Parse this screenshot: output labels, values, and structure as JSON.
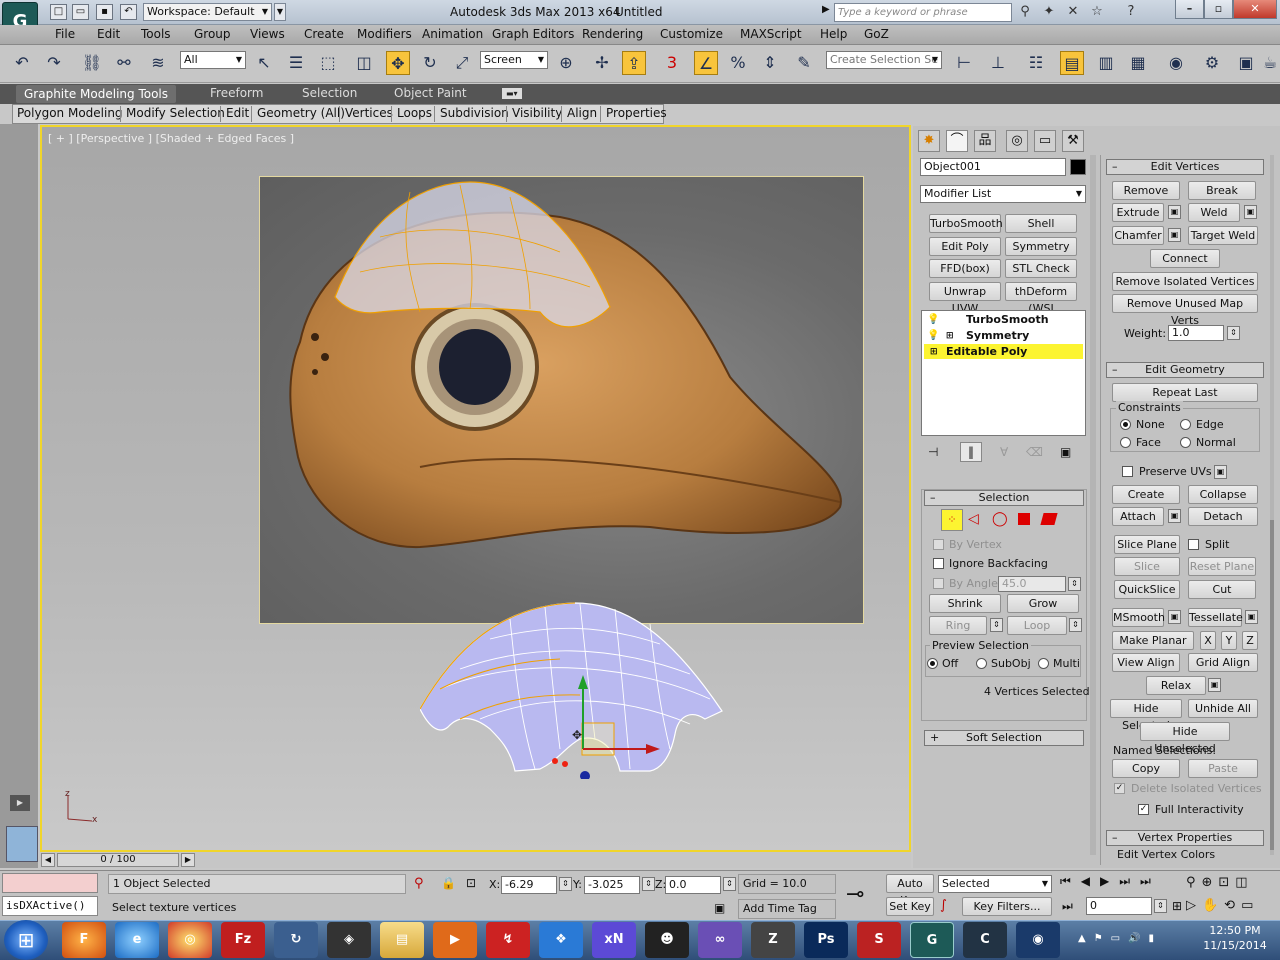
{
  "titlebar": {
    "app_icon": "3ds-max-logo",
    "workspace": "Workspace: Default",
    "app_title": "Autodesk 3ds Max  2013 x64",
    "document": "Untitled",
    "search_placeholder": "Type a keyword or phrase"
  },
  "menubar": [
    "File",
    "Edit",
    "Tools",
    "Group",
    "Views",
    "Create",
    "Modifiers",
    "Animation",
    "Graph Editors",
    "Rendering",
    "Customize",
    "MAXScript",
    "Help",
    "GoZ"
  ],
  "toolbar": {
    "selection_filter": "All",
    "ref_coord": "Screen",
    "named_selection_placeholder": "Create Selection Se",
    "snap_label": "3"
  },
  "ribbon": {
    "tabs": [
      "Graphite Modeling Tools",
      "Freeform",
      "Selection",
      "Object Paint"
    ],
    "active_tab": "Graphite Modeling Tools",
    "panels": [
      "Polygon Modeling",
      "Modify Selection",
      "Edit",
      "Geometry (All)",
      "Vertices",
      "Loops",
      "Subdivision",
      "Visibility",
      "Align",
      "Properties"
    ]
  },
  "viewport": {
    "label": "[ + ] [Perspective ] [Shaded + Edged Faces ]",
    "axis_x": "x",
    "axis_z": "z"
  },
  "command_panel": {
    "object_name": "Object001",
    "modifier_list": "Modifier List",
    "modifier_buttons": [
      "TurboSmooth",
      "Shell",
      "Edit Poly",
      "Symmetry",
      "FFD(box)",
      "STL Check",
      "Unwrap UVW",
      "thDeform (WSI"
    ],
    "stack": [
      {
        "label": "TurboSmooth",
        "selected": false
      },
      {
        "label": "Symmetry",
        "selected": false
      },
      {
        "label": "Editable Poly",
        "selected": true
      }
    ],
    "selection": {
      "title": "Selection",
      "by_vertex": "By Vertex",
      "ignore_backfacing": "Ignore Backfacing",
      "by_angle": "By Angle:",
      "angle_value": "45.0",
      "shrink": "Shrink",
      "grow": "Grow",
      "ring": "Ring",
      "loop": "Loop",
      "preview_title": "Preview Selection",
      "preview_off": "Off",
      "preview_subobj": "SubObj",
      "preview_multi": "Multi",
      "status": "4 Vertices Selected"
    },
    "soft_selection": "Soft Selection"
  },
  "edit_vertices": {
    "title": "Edit Vertices",
    "remove": "Remove",
    "break": "Break",
    "extrude": "Extrude",
    "weld": "Weld",
    "chamfer": "Chamfer",
    "target_weld": "Target Weld",
    "connect": "Connect",
    "remove_isolated": "Remove Isolated Vertices",
    "remove_unused": "Remove Unused Map Verts",
    "weight_label": "Weight:",
    "weight_value": "1.0"
  },
  "edit_geometry": {
    "title": "Edit Geometry",
    "repeat_last": "Repeat Last",
    "constraints": "Constraints",
    "none": "None",
    "edge": "Edge",
    "face": "Face",
    "normal": "Normal",
    "preserve_uvs": "Preserve UVs",
    "create": "Create",
    "collapse": "Collapse",
    "attach": "Attach",
    "detach": "Detach",
    "slice_plane": "Slice Plane",
    "split": "Split",
    "slice": "Slice",
    "reset_plane": "Reset Plane",
    "quickslice": "QuickSlice",
    "cut": "Cut",
    "msmooth": "MSmooth",
    "tessellate": "Tessellate",
    "make_planar": "Make Planar",
    "x": "X",
    "y": "Y",
    "z": "Z",
    "view_align": "View Align",
    "grid_align": "Grid Align",
    "relax": "Relax",
    "hide_selected": "Hide Selected",
    "unhide_all": "Unhide All",
    "hide_unselected": "Hide Unselected",
    "named_selections": "Named Selections:",
    "copy": "Copy",
    "paste": "Paste",
    "delete_isolated": "Delete Isolated Vertices",
    "full_interactivity": "Full Interactivity"
  },
  "vertex_properties": {
    "title": "Vertex Properties",
    "edit_vertex_colors": "Edit Vertex Colors"
  },
  "timeline": {
    "frame": "0 / 100"
  },
  "status": {
    "script_listener": "isDXActive()",
    "selected": "1 Object Selected",
    "prompt": "Select texture vertices",
    "x_label": "X:",
    "x": "-6.29",
    "y_label": "Y:",
    "y": "-3.025",
    "z_label": "Z:",
    "z": "0.0",
    "grid": "Grid = 10.0",
    "add_time_tag": "Add Time Tag",
    "auto_key": "Auto Key",
    "set_key": "Set Key",
    "key_mode": "Selected",
    "key_filters": "Key Filters...",
    "frame_value": "0"
  },
  "taskbar": {
    "apps": [
      "firefox",
      "internet-explorer",
      "chrome",
      "filezilla",
      "app",
      "unity",
      "explorer",
      "media-player",
      "app",
      "dropbox",
      "app",
      "app",
      "visual-studio",
      "zbrush",
      "photoshop",
      "app",
      "3ds-max",
      "app",
      "app"
    ],
    "time": "12:50 PM",
    "date": "11/15/2014"
  },
  "colors": {
    "viewport_border": "#f0d52a",
    "selected_stack": "#fcf431",
    "mesh_fill": "#b9b9f0",
    "mesh_edge": "#f0a000",
    "leather": "#c08848"
  }
}
